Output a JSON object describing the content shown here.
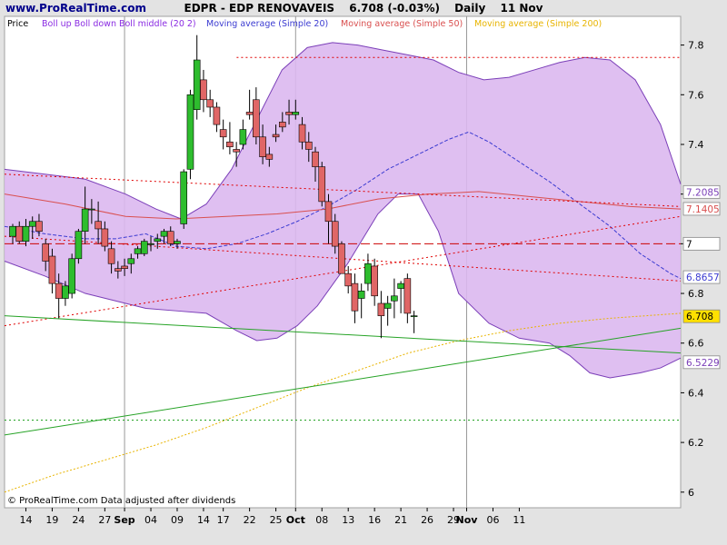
{
  "header": {
    "site": "www.ProRealTime.com",
    "symbol_title": "EDPR - EDP RENOVAVEIS",
    "price_change": "6.708 (-0.03%)",
    "period": "Daily",
    "date": "11 Nov"
  },
  "legend": {
    "price": "Price",
    "boll": "Boll up Boll down Boll middle (20 2)",
    "ma20": "Moving average (Simple 20)",
    "ma50": "Moving average (Simple 50)",
    "ma200": "Moving average (Simple 200)"
  },
  "footer": "© ProRealTime.com Data adjusted after dividends",
  "colors": {
    "background": "#ffffff",
    "outer": "#e3e3e3",
    "bull": "#2ebd2e",
    "bear": "#e06666",
    "band_fill": "#dcb8f0",
    "band_line": "#7b3fb8",
    "ma20": "#3b3bd1",
    "ma50": "#d94f4f",
    "ma200": "#e8b400",
    "trend_green": "#26a326",
    "dotted_red": "#e00000",
    "dashed_red": "#cc0000"
  },
  "chart_data": {
    "type": "candlestick",
    "title": "EDPR - EDP RENOVAVEIS",
    "ylim": [
      5.97,
      7.89
    ],
    "x_ticks": [
      "14",
      "19",
      "24",
      "27",
      "Sep",
      "04",
      "09",
      "14",
      "17",
      "22",
      "25",
      "Oct",
      "08",
      "13",
      "16",
      "21",
      "26",
      "29",
      "Nov",
      "06",
      "11"
    ],
    "x_tick_index": [
      2,
      6,
      10,
      14,
      17,
      21,
      25,
      29,
      32,
      36,
      40,
      43,
      47,
      51,
      55,
      59,
      63,
      67,
      69,
      73,
      77
    ],
    "month_dividers": [
      17,
      43,
      69
    ],
    "y_ticks": [
      6,
      6.2,
      6.4,
      6.6,
      6.8,
      7,
      7.2,
      7.4,
      7.6,
      7.8
    ],
    "price_labels": [
      {
        "text": "7.2085",
        "value": 7.2085,
        "color": "#7b3fb8"
      },
      {
        "text": "7.1405",
        "value": 7.1405,
        "color": "#d94f4f"
      },
      {
        "text": "7",
        "value": 7.0,
        "color": "#000000"
      },
      {
        "text": "6.8657",
        "value": 6.8657,
        "color": "#3b3bd1"
      },
      {
        "text": "6.708",
        "value": 6.708,
        "color": "#000000",
        "bg": "#ffe000"
      },
      {
        "text": "6.5229",
        "value": 6.5229,
        "color": "#7b3fb8"
      }
    ],
    "ohlc": [
      [
        7.03,
        7.08,
        7.0,
        7.07
      ],
      [
        7.07,
        7.09,
        7.0,
        7.01
      ],
      [
        7.01,
        7.1,
        6.99,
        7.07
      ],
      [
        7.07,
        7.11,
        7.02,
        7.09
      ],
      [
        7.09,
        7.12,
        7.03,
        7.05
      ],
      [
        7.0,
        7.02,
        6.89,
        6.93
      ],
      [
        6.95,
        6.98,
        6.8,
        6.84
      ],
      [
        6.84,
        6.88,
        6.7,
        6.78
      ],
      [
        6.78,
        6.85,
        6.75,
        6.83
      ],
      [
        6.8,
        6.96,
        6.78,
        6.94
      ],
      [
        6.94,
        7.06,
        6.92,
        7.05
      ],
      [
        7.05,
        7.23,
        7.0,
        7.14
      ],
      [
        7.14,
        7.18,
        7.08,
        7.14
      ],
      [
        7.09,
        7.17,
        7.0,
        7.06
      ],
      [
        7.06,
        7.09,
        6.97,
        6.99
      ],
      [
        6.98,
        7.01,
        6.88,
        6.92
      ],
      [
        6.9,
        6.93,
        6.86,
        6.89
      ],
      [
        6.91,
        6.94,
        6.87,
        6.9
      ],
      [
        6.92,
        6.96,
        6.88,
        6.94
      ],
      [
        6.96,
        6.99,
        6.94,
        6.98
      ],
      [
        6.96,
        7.02,
        6.95,
        7.01
      ],
      [
        7.0,
        7.03,
        6.97,
        7.0
      ],
      [
        7.01,
        7.04,
        6.98,
        7.02
      ],
      [
        7.03,
        7.06,
        7.0,
        7.05
      ],
      [
        7.05,
        7.07,
        6.99,
        7.0
      ],
      [
        7.0,
        7.02,
        6.98,
        7.01
      ],
      [
        7.08,
        7.3,
        7.06,
        7.29
      ],
      [
        7.3,
        7.62,
        7.26,
        7.6
      ],
      [
        7.54,
        7.84,
        7.5,
        7.74
      ],
      [
        7.66,
        7.7,
        7.53,
        7.58
      ],
      [
        7.58,
        7.62,
        7.51,
        7.55
      ],
      [
        7.55,
        7.57,
        7.45,
        7.48
      ],
      [
        7.46,
        7.5,
        7.38,
        7.43
      ],
      [
        7.41,
        7.49,
        7.36,
        7.39
      ],
      [
        7.38,
        7.41,
        7.31,
        7.37
      ],
      [
        7.4,
        7.5,
        7.38,
        7.46
      ],
      [
        7.53,
        7.62,
        7.5,
        7.52
      ],
      [
        7.58,
        7.63,
        7.4,
        7.43
      ],
      [
        7.43,
        7.48,
        7.32,
        7.35
      ],
      [
        7.36,
        7.39,
        7.31,
        7.34
      ],
      [
        7.44,
        7.48,
        7.41,
        7.43
      ],
      [
        7.49,
        7.53,
        7.45,
        7.47
      ],
      [
        7.53,
        7.58,
        7.48,
        7.52
      ],
      [
        7.52,
        7.58,
        7.5,
        7.53
      ],
      [
        7.48,
        7.51,
        7.38,
        7.41
      ],
      [
        7.41,
        7.45,
        7.33,
        7.38
      ],
      [
        7.37,
        7.39,
        7.25,
        7.31
      ],
      [
        7.31,
        7.33,
        7.15,
        7.17
      ],
      [
        7.17,
        7.2,
        7.0,
        7.09
      ],
      [
        7.09,
        7.12,
        6.96,
        6.99
      ],
      [
        7.0,
        7.01,
        6.88,
        6.88
      ],
      [
        6.88,
        6.91,
        6.8,
        6.83
      ],
      [
        6.84,
        6.88,
        6.68,
        6.73
      ],
      [
        6.78,
        6.84,
        6.7,
        6.81
      ],
      [
        6.84,
        6.96,
        6.81,
        6.92
      ],
      [
        6.91,
        6.94,
        6.75,
        6.79
      ],
      [
        6.76,
        6.81,
        6.62,
        6.71
      ],
      [
        6.74,
        6.79,
        6.67,
        6.76
      ],
      [
        6.77,
        6.86,
        6.7,
        6.79
      ],
      [
        6.82,
        6.85,
        6.72,
        6.84
      ],
      [
        6.86,
        6.88,
        6.68,
        6.72
      ],
      [
        6.71,
        6.73,
        6.64,
        6.71
      ]
    ],
    "boll_upper": [
      [
        0,
        7.3
      ],
      [
        8,
        7.28
      ],
      [
        16,
        7.26
      ],
      [
        24,
        7.2
      ],
      [
        30,
        7.14
      ],
      [
        35,
        7.1
      ],
      [
        40,
        7.16
      ],
      [
        45,
        7.3
      ],
      [
        50,
        7.5
      ],
      [
        55,
        7.7
      ],
      [
        60,
        7.79
      ],
      [
        65,
        7.81
      ],
      [
        70,
        7.8
      ],
      [
        75,
        7.78
      ],
      [
        80,
        7.76
      ],
      [
        85,
        7.74
      ],
      [
        90,
        7.69
      ],
      [
        95,
        7.66
      ],
      [
        100,
        7.67
      ],
      [
        105,
        7.7
      ],
      [
        110,
        7.73
      ],
      [
        115,
        7.75
      ],
      [
        120,
        7.74
      ],
      [
        125,
        7.66
      ],
      [
        130,
        7.48
      ],
      [
        134,
        7.24
      ]
    ],
    "boll_lower": [
      [
        0,
        6.93
      ],
      [
        8,
        6.87
      ],
      [
        16,
        6.8
      ],
      [
        22,
        6.77
      ],
      [
        28,
        6.74
      ],
      [
        34,
        6.73
      ],
      [
        40,
        6.72
      ],
      [
        46,
        6.65
      ],
      [
        50,
        6.61
      ],
      [
        54,
        6.62
      ],
      [
        58,
        6.67
      ],
      [
        62,
        6.75
      ],
      [
        68,
        6.92
      ],
      [
        74,
        7.12
      ],
      [
        78,
        7.2
      ],
      [
        82,
        7.2
      ],
      [
        86,
        7.05
      ],
      [
        90,
        6.8
      ],
      [
        96,
        6.68
      ],
      [
        102,
        6.62
      ],
      [
        108,
        6.6
      ],
      [
        112,
        6.55
      ],
      [
        116,
        6.48
      ],
      [
        120,
        6.46
      ],
      [
        126,
        6.48
      ],
      [
        130,
        6.5
      ],
      [
        134,
        6.54
      ]
    ],
    "ma20": [
      [
        0,
        7.07
      ],
      [
        8,
        7.04
      ],
      [
        16,
        7.02
      ],
      [
        22,
        7.02
      ],
      [
        28,
        7.04
      ],
      [
        34,
        6.99
      ],
      [
        40,
        6.98
      ],
      [
        46,
        7.0
      ],
      [
        52,
        7.04
      ],
      [
        58,
        7.09
      ],
      [
        64,
        7.15
      ],
      [
        70,
        7.22
      ],
      [
        76,
        7.3
      ],
      [
        82,
        7.36
      ],
      [
        88,
        7.42
      ],
      [
        92,
        7.45
      ],
      [
        96,
        7.41
      ],
      [
        102,
        7.33
      ],
      [
        108,
        7.25
      ],
      [
        114,
        7.16
      ],
      [
        120,
        7.07
      ],
      [
        126,
        6.96
      ],
      [
        132,
        6.88
      ],
      [
        134,
        6.86
      ]
    ],
    "ma50": [
      [
        0,
        7.2
      ],
      [
        12,
        7.16
      ],
      [
        24,
        7.11
      ],
      [
        34,
        7.1
      ],
      [
        44,
        7.11
      ],
      [
        54,
        7.12
      ],
      [
        64,
        7.14
      ],
      [
        74,
        7.18
      ],
      [
        84,
        7.2
      ],
      [
        94,
        7.21
      ],
      [
        104,
        7.19
      ],
      [
        114,
        7.17
      ],
      [
        124,
        7.15
      ],
      [
        134,
        7.14
      ]
    ],
    "ma200": [
      [
        0,
        6.0
      ],
      [
        10,
        6.07
      ],
      [
        20,
        6.13
      ],
      [
        30,
        6.19
      ],
      [
        40,
        6.26
      ],
      [
        50,
        6.34
      ],
      [
        60,
        6.42
      ],
      [
        70,
        6.49
      ],
      [
        80,
        6.56
      ],
      [
        90,
        6.61
      ],
      [
        100,
        6.65
      ],
      [
        110,
        6.68
      ],
      [
        120,
        6.7
      ],
      [
        134,
        6.72
      ]
    ],
    "levels": [
      {
        "style": "dotted",
        "color": "#e00000",
        "value": 7.75,
        "from": 46,
        "to": 134
      },
      {
        "style": "dashed",
        "color": "#cc0000",
        "value": 7.0,
        "from": 0,
        "to": 134
      },
      {
        "style": "dotted",
        "color": "#23a323",
        "value": 6.29,
        "from": 0,
        "to": 134
      }
    ],
    "trendlines": [
      {
        "style": "dotted",
        "color": "#e00000",
        "from": [
          0,
          7.28
        ],
        "to": [
          134,
          7.15
        ]
      },
      {
        "style": "dotted",
        "color": "#e00000",
        "from": [
          0,
          7.03
        ],
        "to": [
          134,
          6.85
        ]
      },
      {
        "style": "dotted",
        "color": "#e00000",
        "from": [
          0,
          6.67
        ],
        "to": [
          134,
          7.11
        ]
      },
      {
        "style": "solid",
        "color": "#26a326",
        "from": [
          0,
          6.71
        ],
        "to": [
          134,
          6.56
        ]
      },
      {
        "style": "solid",
        "color": "#26a326",
        "from": [
          0,
          6.23
        ],
        "to": [
          134,
          6.66
        ]
      }
    ]
  }
}
